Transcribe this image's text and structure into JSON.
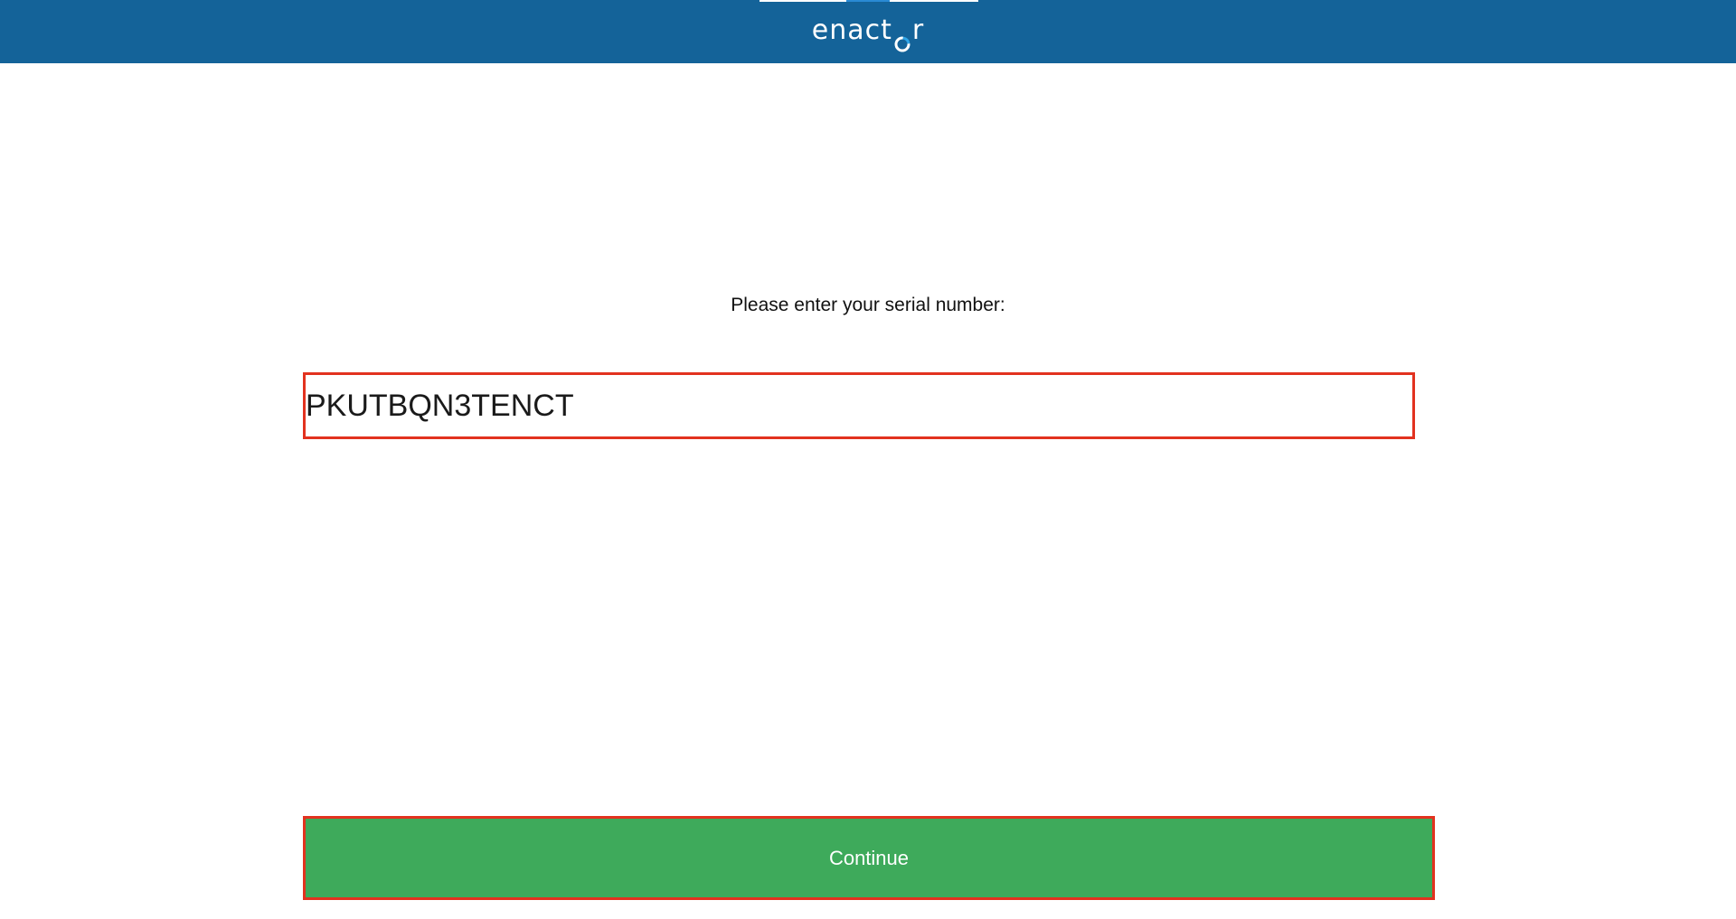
{
  "header": {
    "logo_text_prefix": "enact",
    "logo_text_suffix": "r",
    "logo_icon": "enactor-o-icon",
    "background_color": "#146399"
  },
  "form": {
    "prompt_label": "Please enter your serial number:",
    "serial_value": "PKUTBQN3TENCT",
    "continue_label": "Continue",
    "button_color": "#3eaa5b",
    "highlight_color": "#e2321f"
  }
}
